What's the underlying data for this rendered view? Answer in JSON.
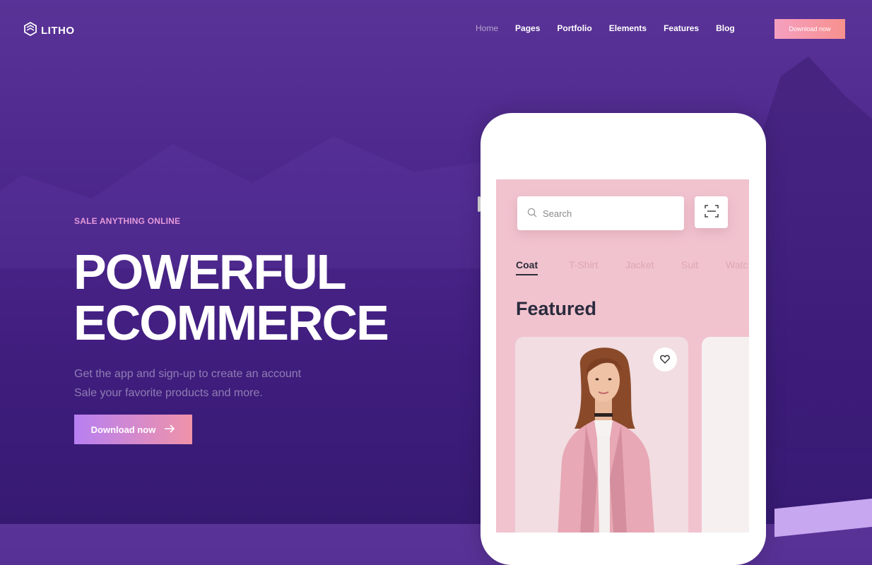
{
  "brand": {
    "name": "LITHO"
  },
  "nav": {
    "items": [
      "Home",
      "Pages",
      "Portfolio",
      "Elements",
      "Features",
      "Blog"
    ]
  },
  "header": {
    "cta_label": "Download now"
  },
  "hero": {
    "eyebrow": "SALE ANYTHING ONLINE",
    "headline_line1": "POWERFUL",
    "headline_line2": "ECOMMERCE",
    "subtext_line1": "Get the app and sign-up to create an account",
    "subtext_line2": "Sale your favorite products and more.",
    "cta_label": "Download now"
  },
  "phone": {
    "search_placeholder": "Search",
    "categories": [
      "Coat",
      "T-Shirt",
      "Jacket",
      "Suit",
      "Watc"
    ],
    "section_title": "Featured"
  },
  "colors": {
    "accent_gradient_start": "#b77ff2",
    "accent_gradient_end": "#f093a9",
    "background": "#4c278c",
    "screen_pink": "#f1c3cf"
  },
  "icons": [
    "logo-icon",
    "arrow-right-icon",
    "search-icon",
    "scan-icon",
    "heart-icon"
  ]
}
